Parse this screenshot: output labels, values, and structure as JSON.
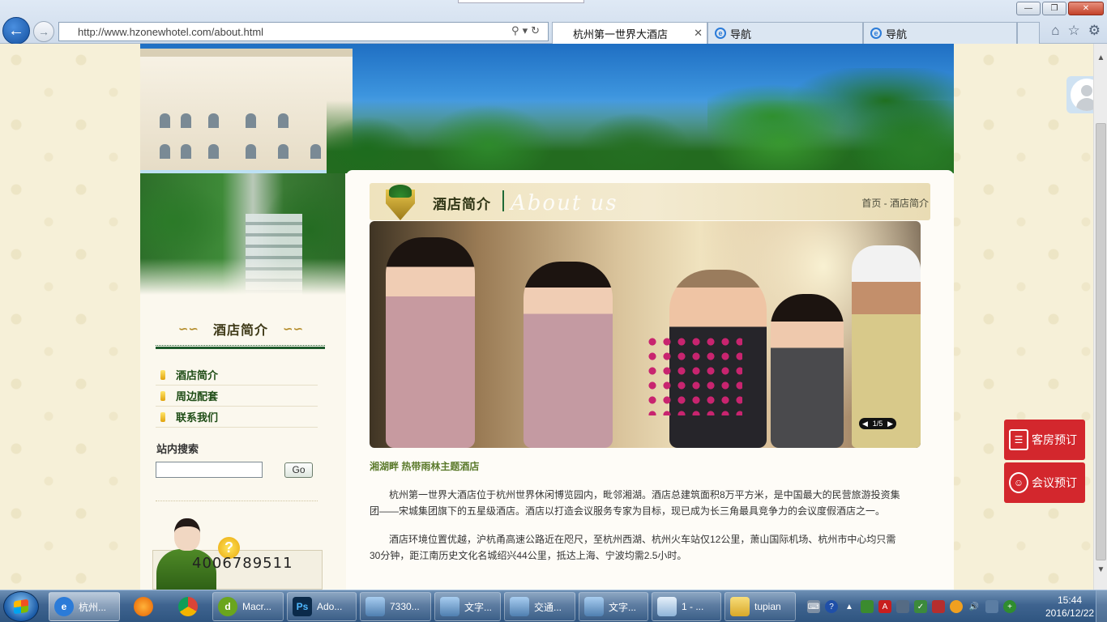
{
  "browser": {
    "address_url": "http://www.hzonewhotel.com/about.html",
    "tabs": [
      {
        "label": "杭州第一世界大酒店",
        "active": true
      },
      {
        "label": "导航",
        "active": false
      },
      {
        "label": "导航",
        "active": false
      }
    ],
    "window_buttons": [
      "—",
      "❐",
      "✕"
    ],
    "icons": [
      "back-arrow-icon",
      "forward-arrow-icon",
      "search-icon",
      "refresh-icon",
      "home-icon",
      "star-icon",
      "gear-icon"
    ]
  },
  "site": {
    "left_panel": {
      "title": "酒店简介",
      "menu": [
        {
          "label": "酒店简介"
        },
        {
          "label": "周边配套"
        },
        {
          "label": "联系我们"
        }
      ],
      "search_label": "站内搜索",
      "search_value": "",
      "search_button": "Go",
      "phone": "4006789511",
      "question_mark": "?"
    },
    "main": {
      "section_title": "酒店简介",
      "section_script": "About us",
      "breadcrumb": "首页 - 酒店简介",
      "slide_counter": "1/5",
      "tagline": "湘湖畔 热带雨林主题酒店",
      "paragraphs": [
        "杭州第一世界大酒店位于杭州世界休闲博览园内，毗邻湘湖。酒店总建筑面积8万平方米，是中国最大的民营旅游投资集团——宋城集团旗下的五星级酒店。酒店以打造会议服务专家为目标，现已成为长三角最具竞争力的会议度假酒店之一。",
        "酒店环境位置优越，沪杭甬高速公路近在咫尺，至杭州西湖、杭州火车站仅12公里，萧山国际机场、杭州市中心均只需30分钟，距江南历史文化名城绍兴44公里，抵达上海、宁波均需2.5小时。"
      ]
    },
    "floating": {
      "room_booking": "客房预订",
      "meeting_booking": "会议预订"
    }
  },
  "taskbar": {
    "items": [
      {
        "label": "杭州...",
        "icon": "ie-icon",
        "color": "#2b7bd8"
      },
      {
        "label": "",
        "icon": "firefox-icon",
        "color": "#e66000"
      },
      {
        "label": "",
        "icon": "chrome-icon",
        "color": "#3a9d3a"
      },
      {
        "label": "Macr...",
        "icon": "dreamweaver-icon",
        "color": "#6aa51d"
      },
      {
        "label": "Ado...",
        "icon": "photoshop-icon",
        "color": "#0b2a4a"
      },
      {
        "label": "7330...",
        "icon": "image-viewer-icon",
        "color": "#4f7fb0"
      },
      {
        "label": "文字...",
        "icon": "image-viewer-icon",
        "color": "#4f7fb0"
      },
      {
        "label": "交通...",
        "icon": "image-viewer-icon",
        "color": "#4f7fb0"
      },
      {
        "label": "文字...",
        "icon": "image-viewer-icon",
        "color": "#4f7fb0"
      },
      {
        "label": "1 - ...",
        "icon": "notepad-icon",
        "color": "#8fb4d8"
      },
      {
        "label": "tupian",
        "icon": "folder-icon",
        "color": "#e8c04a"
      }
    ],
    "clock_time": "15:44",
    "clock_date": "2016/12/22"
  }
}
